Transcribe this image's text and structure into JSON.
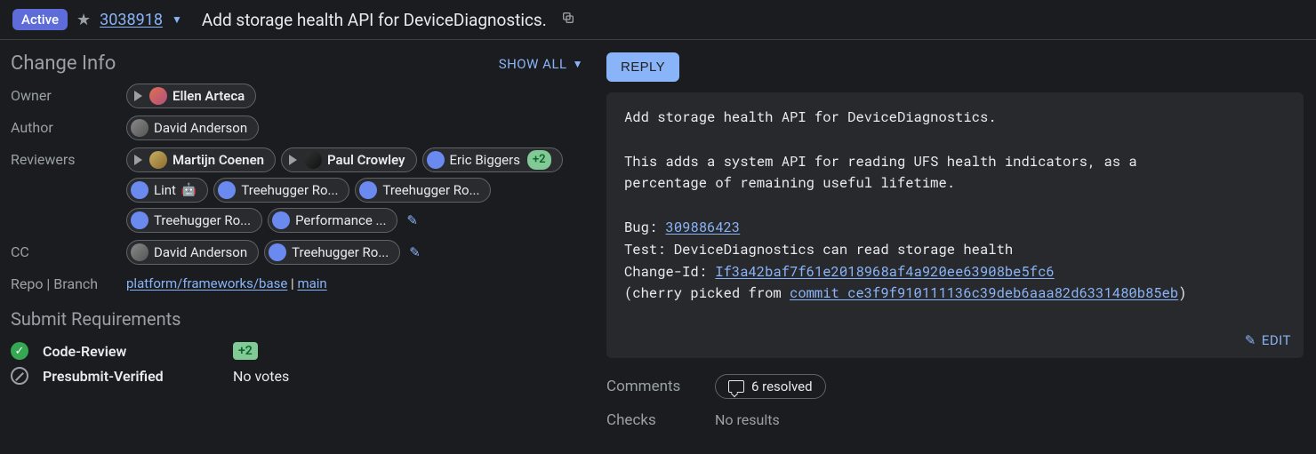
{
  "header": {
    "status": "Active",
    "change_number": "3038918",
    "title": "Add storage health API for DeviceDiagnostics."
  },
  "left": {
    "heading": "Change Info",
    "show_all": "SHOW ALL",
    "owner_label": "Owner",
    "author_label": "Author",
    "reviewers_label": "Reviewers",
    "cc_label": "CC",
    "repo_label": "Repo | Branch",
    "owner": "Ellen Arteca",
    "author": "David Anderson",
    "reviewers": {
      "martijn": "Martijn Coenen",
      "paul": "Paul Crowley",
      "eric": "Eric Biggers",
      "eric_vote": "+2",
      "lint": "Lint",
      "th1": "Treehugger Ro...",
      "th2": "Treehugger Ro...",
      "th3": "Treehugger Ro...",
      "perf": "Performance ..."
    },
    "cc": {
      "david": "David Anderson",
      "th": "Treehugger Ro..."
    },
    "repo": "platform/frameworks/base",
    "repo_sep": " | ",
    "branch": "main",
    "submit_heading": "Submit Requirements",
    "req1_name": "Code-Review",
    "req1_value": "+2",
    "req2_name": "Presubmit-Verified",
    "req2_value": "No votes"
  },
  "right": {
    "reply": "REPLY",
    "desc_line1": "Add storage health API for DeviceDiagnostics.",
    "desc_body": "This adds a system API for reading UFS health indicators, as a\npercentage of remaining useful lifetime.",
    "bug_label": "Bug: ",
    "bug_link": "309886423",
    "test_line": "Test: DeviceDiagnostics can read storage health",
    "changeid_label": "Change-Id: ",
    "changeid_link": "If3a42baf7f61e2018968af4a920ee63908be5fc6",
    "cherry_prefix": "(cherry picked from ",
    "cherry_link": "commit ce3f9f910111136c39deb6aaa82d6331480b85eb",
    "cherry_suffix": ")",
    "edit": "EDIT",
    "comments_label": "Comments",
    "comments_value": "6 resolved",
    "checks_label": "Checks",
    "checks_value": "No results"
  }
}
